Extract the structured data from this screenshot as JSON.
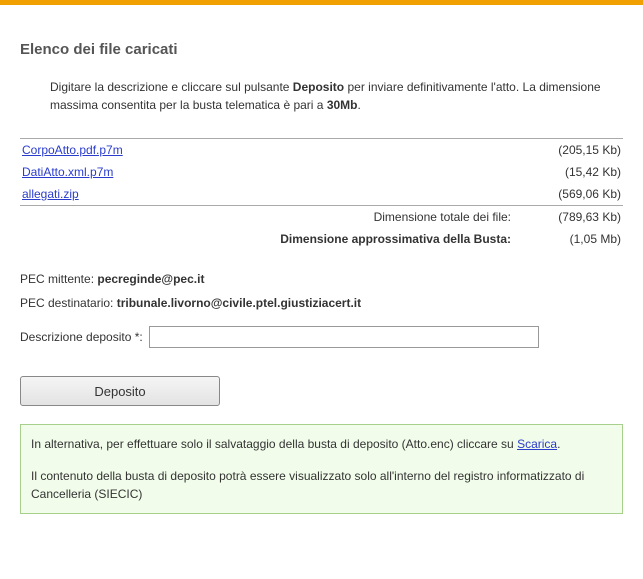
{
  "title": "Elenco dei file caricati",
  "intro": {
    "p1a": "Digitare la descrizione e cliccare sul pulsante ",
    "p1b": "Deposito",
    "p1c": " per inviare definitivamente l'atto. La dimensione massima consentita per la busta telematica è pari a ",
    "p1d": "30Mb",
    "p1e": "."
  },
  "files": [
    {
      "name": "CorpoAtto.pdf.p7m",
      "size": "(205,15 Kb)"
    },
    {
      "name": "DatiAtto.xml.p7m",
      "size": "(15,42 Kb)"
    },
    {
      "name": "allegati.zip",
      "size": "(569,06 Kb)"
    }
  ],
  "totals": {
    "files_label": "Dimensione totale dei file:",
    "files_value": "(789,63 Kb)",
    "envelope_label": "Dimensione approssimativa della Busta:",
    "envelope_value": "(1,05 Mb)"
  },
  "pec_sender": {
    "label": "PEC mittente: ",
    "value": "pecreginde@pec.it"
  },
  "pec_recipient": {
    "label": "PEC destinatario: ",
    "value": "tribunale.livorno@civile.ptel.giustiziacert.it"
  },
  "description": {
    "label": "Descrizione deposito *:",
    "value": ""
  },
  "button_label": "Deposito",
  "altbox": {
    "t1": "In alternativa, per effettuare solo il salvataggio della busta di deposito (Atto.enc) cliccare su ",
    "link": "Scarica",
    "t2": ".",
    "t3": "Il contenuto della busta di deposito potrà essere visualizzato solo all'interno del registro informatizzato di Cancelleria (SIECIC)"
  }
}
